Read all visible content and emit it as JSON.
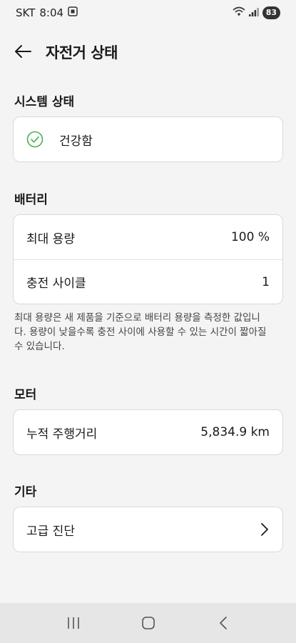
{
  "status_bar": {
    "carrier": "SKT",
    "time": "8:04",
    "battery": "83"
  },
  "header": {
    "title": "자전거 상태"
  },
  "system": {
    "section_title": "시스템 상태",
    "status_text": "건강함",
    "status_icon": "check-circle-icon",
    "status_color": "#4caf50"
  },
  "battery": {
    "section_title": "배터리",
    "max_capacity_label": "최대 용량",
    "max_capacity_value": "100 %",
    "charge_cycle_label": "충전 사이클",
    "charge_cycle_value": "1",
    "note": "최대 용량은 새 제품을 기준으로 배터리 용량을 측정한 값입니다. 용량이 낮을수록 충전 사이에 사용할 수 있는 시간이 짧아질 수 있습니다."
  },
  "motor": {
    "section_title": "모터",
    "odometer_label": "누적 주행거리",
    "odometer_value": "5,834.9 km"
  },
  "other": {
    "section_title": "기타",
    "advanced_diagnosis_label": "고급 진단"
  },
  "nav": {
    "recents_icon": "recents-icon",
    "home_icon": "home-icon",
    "back_icon": "back-icon"
  }
}
